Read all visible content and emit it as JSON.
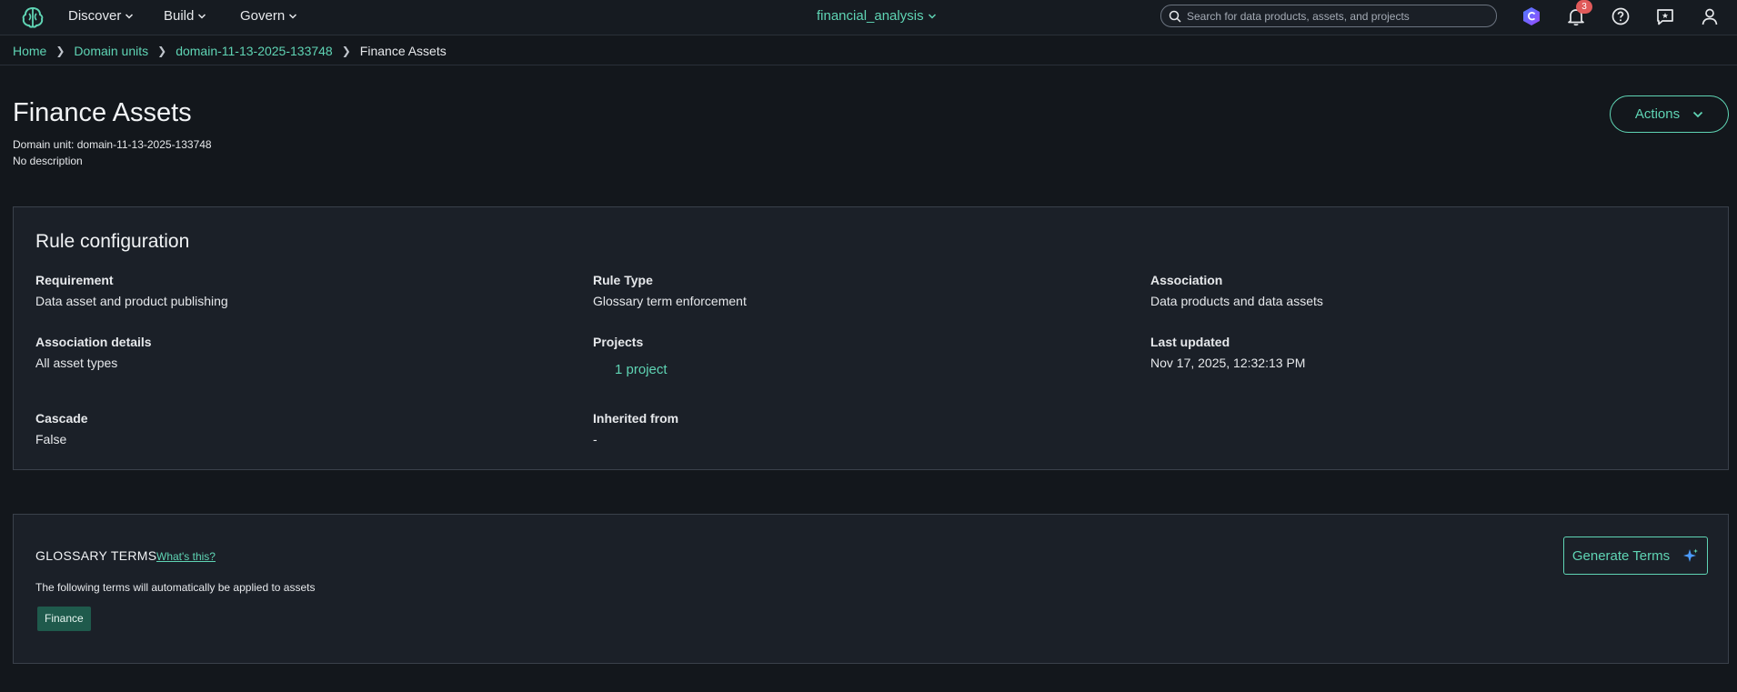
{
  "nav": {
    "items": [
      {
        "label": "Discover"
      },
      {
        "label": "Build"
      },
      {
        "label": "Govern"
      }
    ],
    "project": "financial_analysis",
    "search_placeholder": "Search for data products, assets, and projects",
    "notification_count": "3"
  },
  "breadcrumb": {
    "home": "Home",
    "domain_units": "Domain units",
    "domain": "domain-11-13-2025-133748",
    "current": "Finance Assets"
  },
  "header": {
    "title": "Finance Assets",
    "domain_unit_label": "Domain unit:",
    "domain_unit_value": "domain-11-13-2025-133748",
    "description": "No description",
    "actions_label": "Actions"
  },
  "rule_config": {
    "title": "Rule configuration",
    "requirement_label": "Requirement",
    "requirement_value": "Data asset and product publishing",
    "rule_type_label": "Rule Type",
    "rule_type_value": "Glossary term enforcement",
    "association_label": "Association",
    "association_value": "Data products and data assets",
    "association_details_label": "Association details",
    "association_details_value": "All asset types",
    "projects_label": "Projects",
    "projects_value": "1 project",
    "last_updated_label": "Last updated",
    "last_updated_value": "Nov 17, 2025, 12:32:13 PM",
    "cascade_label": "Cascade",
    "cascade_value": "False",
    "inherited_label": "Inherited from",
    "inherited_value": "-"
  },
  "glossary": {
    "title": "GLOSSARY TERMS",
    "whats_this": "What's this?",
    "description": "The following terms will automatically be applied to assets",
    "terms": [
      "Finance"
    ],
    "generate_label": "Generate Terms"
  },
  "colors": {
    "accent": "#5fd4b4",
    "background": "#13171c",
    "panel": "#1b2028",
    "badge": "#e05a5a",
    "tag": "#1f5a4c"
  }
}
